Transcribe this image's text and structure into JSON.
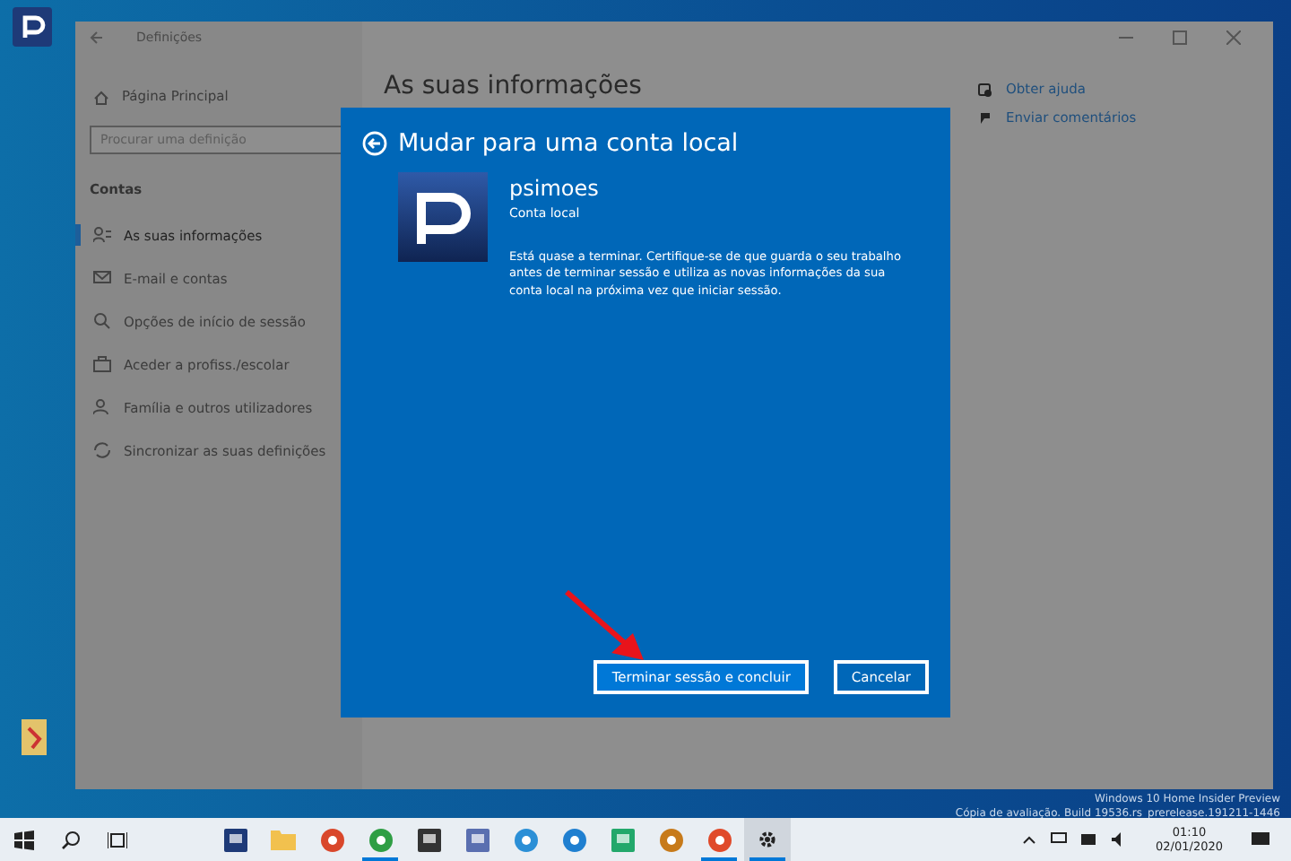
{
  "window": {
    "title": "Definições"
  },
  "sidebar": {
    "home": "Página Principal",
    "search": {
      "placeholder": "Procurar uma definição"
    },
    "section": "Contas",
    "items": [
      {
        "label": "As suas informações",
        "selected": true
      },
      {
        "label": "E-mail e contas",
        "selected": false
      },
      {
        "label": "Opções de início de sessão",
        "selected": false
      },
      {
        "label": "Aceder a profiss./escolar",
        "selected": false
      },
      {
        "label": "Família e outros utilizadores",
        "selected": false
      },
      {
        "label": "Sincronizar as suas definições",
        "selected": false
      }
    ]
  },
  "main": {
    "heading": "As suas informações",
    "links": [
      {
        "label": "Obter ajuda"
      },
      {
        "label": "Enviar comentários"
      }
    ]
  },
  "dialog": {
    "title": "Mudar para uma conta local",
    "user_name": "psimoes",
    "account_type": "Conta local",
    "message": "Está quase a terminar. Certifique-se de que guarda o seu trabalho antes de terminar sessão e utiliza as novas informações da sua conta local na próxima vez que iniciar sessão.",
    "buttons": [
      {
        "label": "Terminar sessão e concluir",
        "primary": true
      },
      {
        "label": "Cancelar",
        "primary": false
      }
    ]
  },
  "watermark": [
    "Windows 10 Home Insider Preview",
    "Cópia de avaliação. Build 19536.rs_prerelease.191211-1446"
  ],
  "taskbar": {
    "apps": [
      {
        "kind": "start",
        "running": false,
        "selected": false
      },
      {
        "kind": "search",
        "running": false,
        "selected": false
      },
      {
        "kind": "taskview",
        "running": false,
        "selected": false
      },
      {
        "kind": "app",
        "color": "#1e3a78",
        "running": false,
        "selected": false
      },
      {
        "kind": "folder",
        "color": "#f2c14e",
        "running": false,
        "selected": false
      },
      {
        "kind": "round",
        "color": "#d9472b",
        "running": false,
        "selected": false
      },
      {
        "kind": "round",
        "color": "#2f9e44",
        "running": true,
        "selected": false
      },
      {
        "kind": "app",
        "color": "#333333",
        "running": false,
        "selected": false
      },
      {
        "kind": "app",
        "color": "#5a6fb0",
        "running": false,
        "selected": false
      },
      {
        "kind": "round",
        "color": "#2b8fd6",
        "running": false,
        "selected": false
      },
      {
        "kind": "round",
        "color": "#1f7fd0",
        "running": false,
        "selected": false
      },
      {
        "kind": "app",
        "color": "#23a86b",
        "running": false,
        "selected": false
      },
      {
        "kind": "round",
        "color": "#c77a1a",
        "running": false,
        "selected": false
      },
      {
        "kind": "round",
        "color": "#e04a2a",
        "running": true,
        "selected": false
      },
      {
        "kind": "gear",
        "running": true,
        "selected": true
      }
    ],
    "time": "01:10",
    "date": "02/01/2020"
  }
}
